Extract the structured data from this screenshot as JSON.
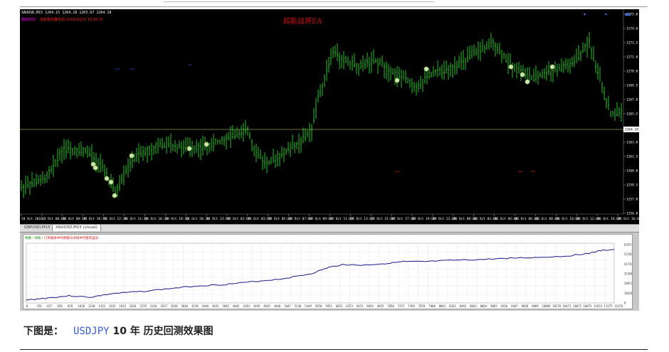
{
  "chart": {
    "ohlc_text": "XAUUSD,M15  1264.15 1264.28 1263.67 1264.18",
    "status_label": "剩余时间",
    "status_text": "当前服务器时间:2016/10/21 10:16:31",
    "ea_title": "超能战将EA",
    "current_price": "1264.18",
    "price_labels": [
      "1275.0",
      "1274.0",
      "1272.5",
      "1271.0",
      "1270.0",
      "1268.5",
      "1267.0",
      "1265.5",
      "1264.0",
      "1263.0",
      "1261.5",
      "1260.0",
      "1258.5",
      "1257.0",
      "1256.0"
    ],
    "time_labels": [
      "18 Oct 2016",
      "18 Oct 06:00",
      "18 Oct 08:30",
      "18 Oct 10:30",
      "18 Oct 12:30",
      "18 Oct 14:30",
      "18 Oct 16:30",
      "18 Oct 18:30",
      "18 Oct 20:30",
      "18 Oct 23:00",
      "19 Oct 01:00",
      "19 Oct 03:00",
      "19 Oct 05:00",
      "19 Oct 07:00",
      "19 Oct 09:00",
      "19 Oct 11:00",
      "19 Oct 13:00",
      "19 Oct 15:00",
      "19 Oct 17:00",
      "19 Oct 19:00",
      "19 Oct 22:00",
      "20 Oct 00:00",
      "20 Oct 02:00",
      "20 Oct 04:00",
      "20 Oct 06:00",
      "20 Oct 08:00",
      "20 Oct 10:00",
      "20 Oct 12:00",
      "20 Oct 14:00",
      "20 Oct 16:00"
    ],
    "colors": {
      "bg": "#000000",
      "candle": "#2bd42b",
      "marker": "#cfe6b0",
      "priceline": "#9b9b5a"
    }
  },
  "tabs": [
    {
      "label": "GBPUSD,M15",
      "active": false
    },
    {
      "label": "XAUUSD,M15 (visual)",
      "active": true
    }
  ],
  "report": {
    "legend_balance": "余额",
    "legend_equity": "净值",
    "legend_note": "/ 订单图表中的余额与净值中可能有差异",
    "y_labels": [
      "62617",
      "52181",
      "41744",
      "31308",
      "20872",
      "10436",
      "0"
    ],
    "x_labels": [
      "0",
      "226",
      "427",
      "628",
      "829",
      "1030",
      "1230",
      "1431",
      "1632",
      "1833",
      "2034",
      "2235",
      "2436",
      "2637",
      "2838",
      "3038",
      "3239",
      "3440",
      "3641",
      "3842",
      "4042",
      "4244",
      "4445",
      "4645",
      "4846",
      "5047",
      "5248",
      "5449",
      "5650",
      "5851",
      "6052",
      "6253",
      "6453",
      "6654",
      "6855",
      "7056",
      "7257",
      "7458",
      "7659",
      "7860",
      "8061",
      "8261",
      "8462",
      "8663",
      "8864",
      "9065",
      "9266",
      "9467",
      "9668",
      "9869",
      "10069",
      "10270",
      "10471",
      "10672",
      "10873",
      "11074",
      "11275",
      "11476"
    ],
    "line_color": "#1a1a8c"
  },
  "caption": {
    "prefix": "下图是：",
    "symbol": "USDJPY",
    "suffix": " 10 年 历史回测效果图"
  }
}
